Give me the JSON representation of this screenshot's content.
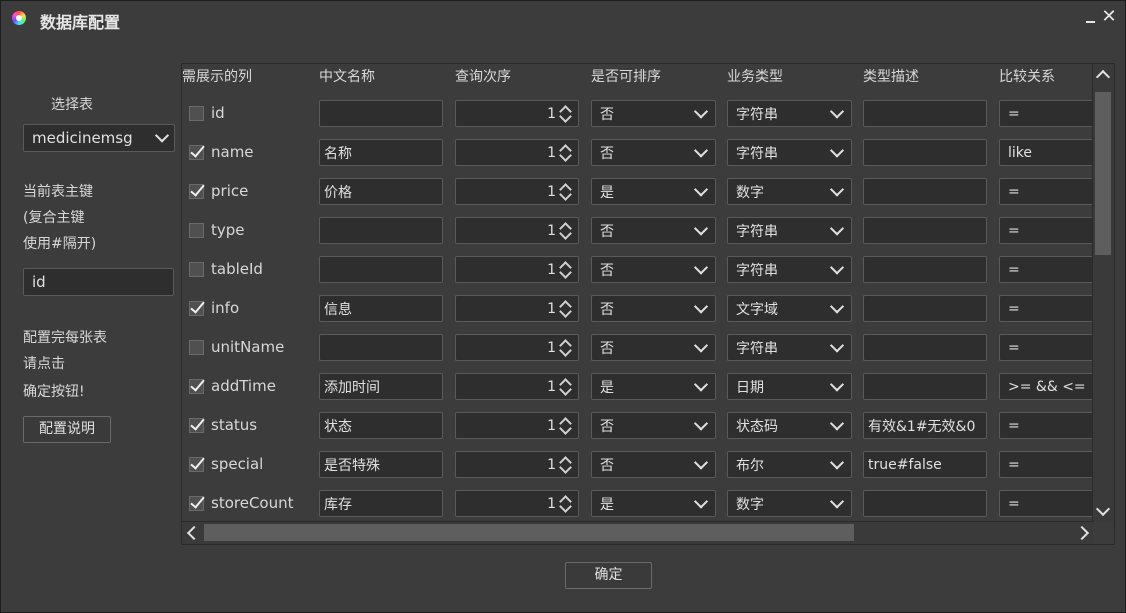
{
  "window": {
    "title": "数据库配置"
  },
  "left": {
    "select_table_label": "选择表",
    "table_select_value": "medicinemsg",
    "pk_label_1": "当前表主键",
    "pk_label_2": "(复合主键",
    "pk_label_3": "使用#隔开)",
    "pk_value": "id",
    "hint_1": "配置完每张表",
    "hint_2": "请点击",
    "hint_3": "确定按钮!",
    "help_button": "配置说明"
  },
  "table": {
    "headers": [
      "需展示的列",
      "中文名称",
      "查询次序",
      "是否可排序",
      "业务类型",
      "类型描述",
      "比较关系"
    ],
    "rows": [
      {
        "checked": false,
        "field": "id",
        "cn": "",
        "order": "1",
        "sortable": "否",
        "type": "字符串",
        "desc": "",
        "compare": "="
      },
      {
        "checked": true,
        "field": "name",
        "cn": "名称",
        "order": "1",
        "sortable": "否",
        "type": "字符串",
        "desc": "",
        "compare": "like"
      },
      {
        "checked": true,
        "field": "price",
        "cn": "价格",
        "order": "1",
        "sortable": "是",
        "type": "数字",
        "desc": "",
        "compare": "="
      },
      {
        "checked": false,
        "field": "type",
        "cn": "",
        "order": "1",
        "sortable": "否",
        "type": "字符串",
        "desc": "",
        "compare": "="
      },
      {
        "checked": false,
        "field": "tableId",
        "cn": "",
        "order": "1",
        "sortable": "否",
        "type": "字符串",
        "desc": "",
        "compare": "="
      },
      {
        "checked": true,
        "field": "info",
        "cn": "信息",
        "order": "1",
        "sortable": "否",
        "type": "文字域",
        "desc": "",
        "compare": "="
      },
      {
        "checked": false,
        "field": "unitName",
        "cn": "",
        "order": "1",
        "sortable": "否",
        "type": "字符串",
        "desc": "",
        "compare": "="
      },
      {
        "checked": true,
        "field": "addTime",
        "cn": "添加时间",
        "order": "1",
        "sortable": "是",
        "type": "日期",
        "desc": "",
        "compare": ">= && <="
      },
      {
        "checked": true,
        "field": "status",
        "cn": "状态",
        "order": "1",
        "sortable": "否",
        "type": "状态码",
        "desc": "有效&1#无效&0",
        "compare": "="
      },
      {
        "checked": true,
        "field": "special",
        "cn": "是否特殊",
        "order": "1",
        "sortable": "否",
        "type": "布尔",
        "desc": "true#false",
        "compare": "="
      },
      {
        "checked": true,
        "field": "storeCount",
        "cn": "库存",
        "order": "1",
        "sortable": "是",
        "type": "数字",
        "desc": "",
        "compare": "="
      }
    ]
  },
  "footer": {
    "ok_button": "确定"
  }
}
